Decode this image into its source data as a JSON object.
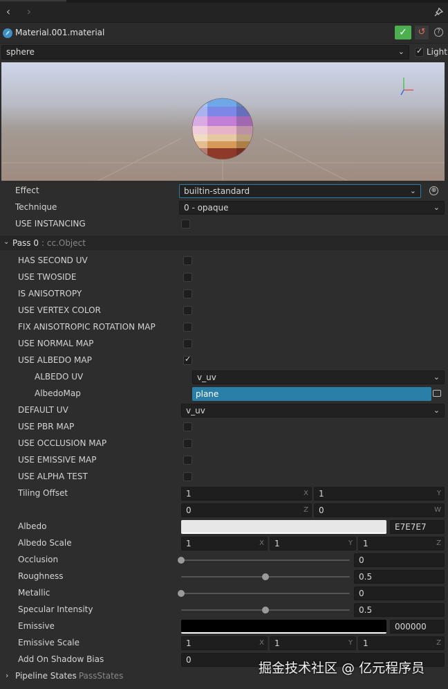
{
  "header": {
    "title": "Material.001.material"
  },
  "preview": {
    "model": "sphere",
    "light_label": "Light",
    "light_checked": true
  },
  "effect": {
    "label": "Effect",
    "value": "builtin-standard"
  },
  "technique": {
    "label": "Technique",
    "value": "0 - opaque"
  },
  "use_instancing": {
    "label": "USE INSTANCING",
    "checked": false
  },
  "pass": {
    "title": "Pass 0",
    "type": ": cc.Object"
  },
  "defines": [
    {
      "label": "HAS SECOND UV",
      "checked": false
    },
    {
      "label": "USE TWOSIDE",
      "checked": false
    },
    {
      "label": "IS ANISOTROPY",
      "checked": false
    },
    {
      "label": "USE VERTEX COLOR",
      "checked": false
    },
    {
      "label": "FIX ANISOTROPIC ROTATION MAP",
      "checked": false
    },
    {
      "label": "USE NORMAL MAP",
      "checked": false
    },
    {
      "label": "USE ALBEDO MAP",
      "checked": true
    }
  ],
  "albedo_uv": {
    "label": "ALBEDO UV",
    "value": "v_uv"
  },
  "albedo_map": {
    "label": "AlbedoMap",
    "value": "plane"
  },
  "default_uv": {
    "label": "DEFAULT UV",
    "value": "v_uv"
  },
  "defines2": [
    {
      "label": "USE PBR MAP",
      "checked": false
    },
    {
      "label": "USE OCCLUSION MAP",
      "checked": false
    },
    {
      "label": "USE EMISSIVE MAP",
      "checked": false
    },
    {
      "label": "USE ALPHA TEST",
      "checked": false
    }
  ],
  "tiling_offset": {
    "label": "Tiling Offset",
    "x": "1",
    "y": "1",
    "z": "0",
    "w": "0"
  },
  "albedo": {
    "label": "Albedo",
    "hex": "E7E7E7",
    "color": "#e7e7e7"
  },
  "albedo_scale": {
    "label": "Albedo Scale",
    "x": "1",
    "y": "1",
    "z": "1"
  },
  "occlusion": {
    "label": "Occlusion",
    "value": "0",
    "fraction": 0
  },
  "roughness": {
    "label": "Roughness",
    "value": "0.5",
    "fraction": 0.5
  },
  "metallic": {
    "label": "Metallic",
    "value": "0",
    "fraction": 0
  },
  "specular": {
    "label": "Specular Intensity",
    "value": "0.5",
    "fraction": 0.5
  },
  "emissive": {
    "label": "Emissive",
    "hex": "000000",
    "color": "#000000"
  },
  "emissive_scale": {
    "label": "Emissive Scale",
    "x": "1",
    "y": "1",
    "z": "1"
  },
  "shadow_bias": {
    "label": "Add On Shadow Bias",
    "value": "0"
  },
  "pipeline": {
    "title": "Pipeline States",
    "type": ": PassStates"
  },
  "axis_letters": {
    "x": "X",
    "y": "Y",
    "z": "Z",
    "w": "W"
  },
  "watermark": "掘金技术社区 @ 亿元程序员",
  "colors": {
    "accent": "#2a7fa8",
    "confirm": "#4caf50",
    "revert": "#e06c5a"
  }
}
